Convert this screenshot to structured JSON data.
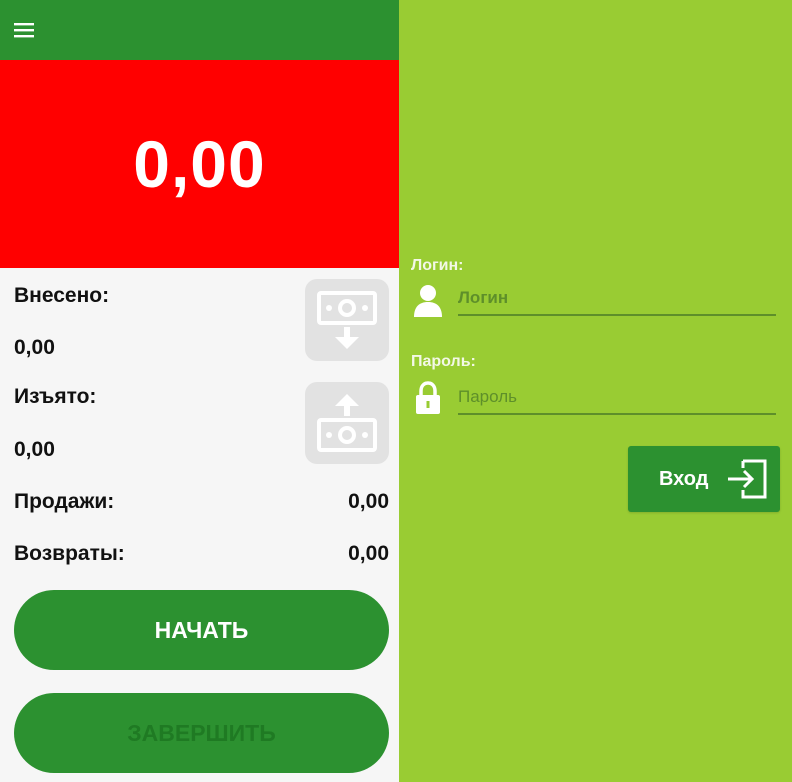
{
  "colors": {
    "appbar": "#2c9130",
    "amount_bg": "#ff0000",
    "left_bg": "#f6f6f6",
    "right_bg": "#99cc33",
    "button_green": "#2c9130",
    "cash_button_bg": "#e2e2e2"
  },
  "left": {
    "menu_icon": "hamburger-menu-icon",
    "amount": "0,00",
    "deposited": {
      "label": "Внесено:",
      "value": "0,00",
      "icon": "cash-deposit-icon"
    },
    "withdrawn": {
      "label": "Изъято:",
      "value": "0,00",
      "icon": "cash-withdraw-icon"
    },
    "sales": {
      "label": "Продажи:",
      "value": "0,00"
    },
    "returns": {
      "label": "Возвраты:",
      "value": "0,00"
    },
    "start_button": "НАЧАТЬ",
    "finish_button": "ЗАВЕРШИТЬ"
  },
  "right": {
    "login": {
      "label": "Логин:",
      "placeholder": "Логин",
      "icon": "user-icon"
    },
    "password": {
      "label": "Пароль:",
      "placeholder": "Пароль",
      "icon": "lock-icon"
    },
    "enter_button": {
      "label": "Вход",
      "icon": "sign-in-icon"
    }
  }
}
